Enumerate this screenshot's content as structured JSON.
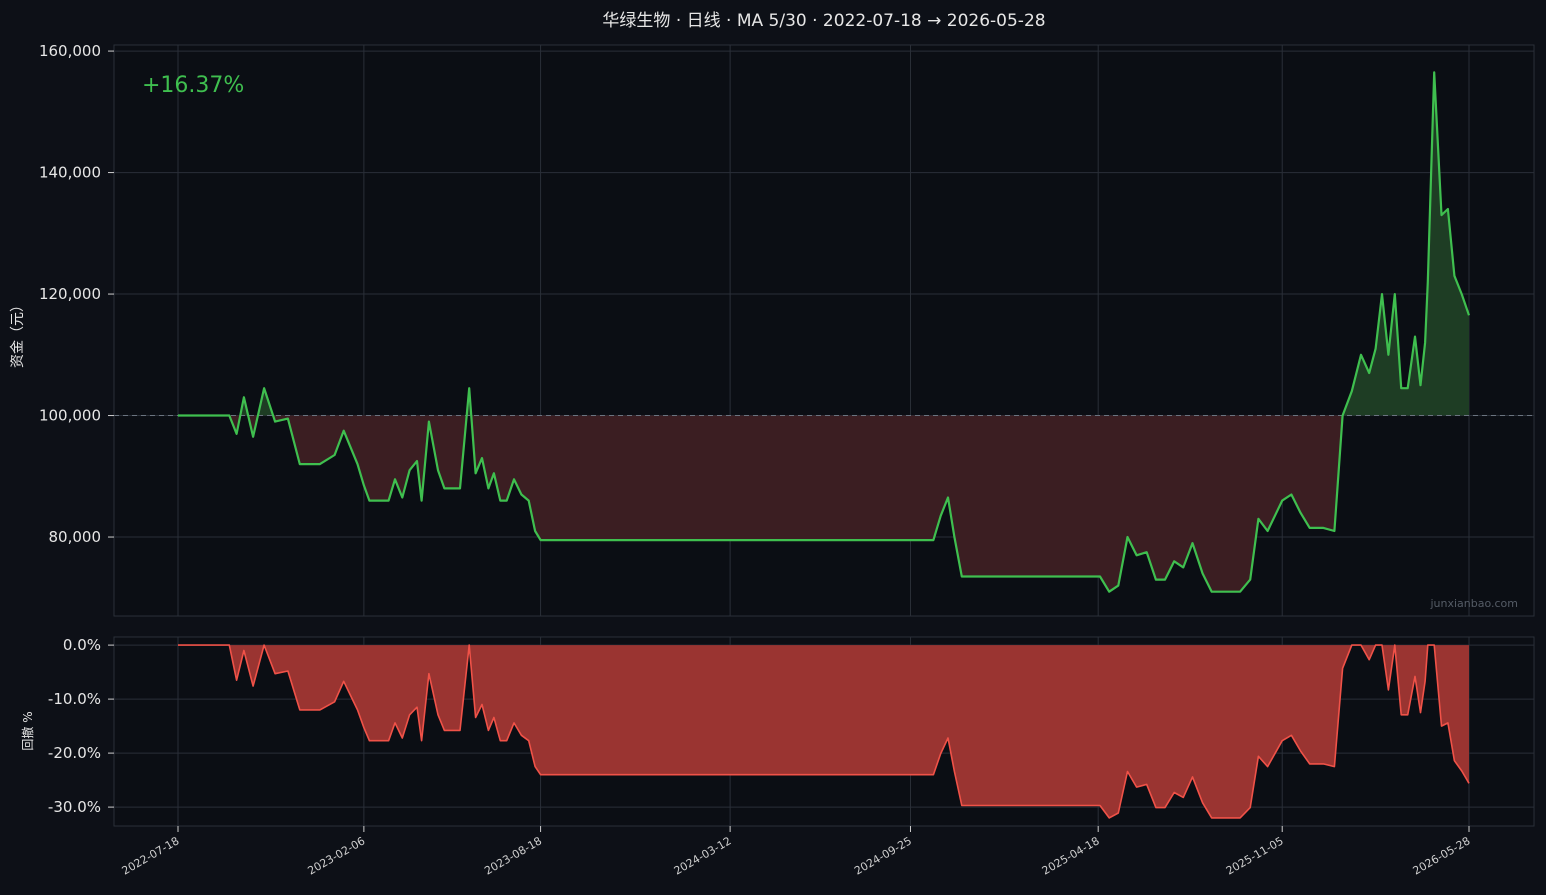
{
  "title": "华绿生物 · 日线 · MA 5/30 · 2022-07-18 → 2026-05-28",
  "return_label": "+16.37%",
  "watermark": "junxianbao.com",
  "colors": {
    "background": "#0d1017",
    "equity_line": "#3fbf4f",
    "equity_up_fill": "#1e3d24",
    "equity_down_fill": "#3b1e22",
    "drawdown": "#f05248",
    "drawdown_fill": "#9a3431",
    "baseline": "#6b7480"
  },
  "chart_data": [
    {
      "type": "area",
      "name": "equity",
      "ylabel": "资金（元）",
      "ylim": [
        67000,
        161000
      ],
      "yticks": [
        80000,
        100000,
        120000,
        140000,
        160000
      ],
      "ytick_labels": [
        "80,000",
        "100,000",
        "120,000",
        "140,000",
        "160,000"
      ],
      "baseline": 100000,
      "x_range": [
        "2022-07-18",
        "2026-05-28"
      ],
      "xticks": [
        "2022-07-18",
        "2023-02-06",
        "2023-08-18",
        "2024-03-12",
        "2024-09-25",
        "2025-04-18",
        "2025-11-05",
        "2026-05-28"
      ],
      "x": [
        "2022-07-18",
        "2022-09-12",
        "2022-09-20",
        "2022-09-28",
        "2022-10-08",
        "2022-10-20",
        "2022-11-01",
        "2022-11-15",
        "2022-11-28",
        "2022-12-05",
        "2022-12-08",
        "2022-12-20",
        "2023-01-05",
        "2023-01-15",
        "2023-01-30",
        "2023-02-06",
        "2023-02-12",
        "2023-02-18",
        "2023-02-25",
        "2023-03-05",
        "2023-03-12",
        "2023-03-20",
        "2023-03-28",
        "2023-04-05",
        "2023-04-10",
        "2023-04-18",
        "2023-04-28",
        "2023-05-05",
        "2023-05-12",
        "2023-05-22",
        "2023-06-01",
        "2023-06-08",
        "2023-06-15",
        "2023-06-22",
        "2023-06-28",
        "2023-07-05",
        "2023-07-12",
        "2023-07-20",
        "2023-07-28",
        "2023-08-05",
        "2023-08-12",
        "2023-08-18",
        "2023-09-01",
        "2024-10-20",
        "2024-10-28",
        "2024-11-05",
        "2024-11-12",
        "2024-11-20",
        "2024-12-01",
        "2025-04-10",
        "2025-04-20",
        "2025-04-30",
        "2025-05-10",
        "2025-05-20",
        "2025-05-30",
        "2025-06-10",
        "2025-06-20",
        "2025-06-30",
        "2025-07-10",
        "2025-07-20",
        "2025-07-30",
        "2025-08-10",
        "2025-08-20",
        "2025-09-20",
        "2025-10-01",
        "2025-10-10",
        "2025-10-20",
        "2025-11-05",
        "2025-11-15",
        "2025-11-25",
        "2025-12-05",
        "2025-12-20",
        "2026-01-01",
        "2026-01-10",
        "2026-01-20",
        "2026-01-30",
        "2026-02-08",
        "2026-02-15",
        "2026-02-22",
        "2026-03-01",
        "2026-03-08",
        "2026-03-15",
        "2026-03-22",
        "2026-03-30",
        "2026-04-05",
        "2026-04-10",
        "2026-04-13",
        "2026-04-20",
        "2026-04-28",
        "2026-05-05",
        "2026-05-12",
        "2026-05-20",
        "2026-05-28"
      ],
      "values": [
        100000,
        100000,
        97000,
        103000,
        96500,
        104500,
        99000,
        99500,
        92000,
        92000,
        92000,
        92000,
        93500,
        97500,
        92000,
        88500,
        86000,
        86000,
        86000,
        86000,
        89500,
        86500,
        91000,
        92500,
        86000,
        99000,
        91000,
        88000,
        88000,
        88000,
        104500,
        90500,
        93000,
        88000,
        90500,
        86000,
        86000,
        89500,
        87000,
        86000,
        81000,
        79500,
        79500,
        79500,
        83500,
        86500,
        80000,
        73500,
        73500,
        73500,
        73500,
        71000,
        72000,
        80000,
        77000,
        77500,
        73000,
        73000,
        76000,
        75000,
        79000,
        74000,
        71000,
        71000,
        73000,
        83000,
        81000,
        86000,
        87000,
        84000,
        81500,
        81500,
        81000,
        100000,
        104000,
        110000,
        107000,
        111000,
        120000,
        110000,
        120000,
        104500,
        104500,
        113000,
        105000,
        112000,
        122000,
        156500,
        133000,
        134000,
        123000,
        120000,
        116500
      ]
    },
    {
      "type": "area",
      "name": "drawdown",
      "ylabel": "回撤 %",
      "ylim": [
        -33.5,
        1.5
      ],
      "yticks": [
        0,
        -10,
        -20,
        -30
      ],
      "ytick_labels": [
        "0.0%",
        "-10.0%",
        "-20.0%",
        "-30.0%"
      ],
      "x_range": [
        "2022-07-18",
        "2026-05-28"
      ],
      "x": [
        "2022-07-18",
        "2022-09-12",
        "2022-09-20",
        "2022-09-28",
        "2022-10-08",
        "2022-10-20",
        "2022-11-01",
        "2022-11-15",
        "2022-11-28",
        "2022-12-05",
        "2022-12-08",
        "2022-12-20",
        "2023-01-05",
        "2023-01-15",
        "2023-01-30",
        "2023-02-06",
        "2023-02-12",
        "2023-02-18",
        "2023-02-25",
        "2023-03-05",
        "2023-03-12",
        "2023-03-20",
        "2023-03-28",
        "2023-04-05",
        "2023-04-10",
        "2023-04-18",
        "2023-04-28",
        "2023-05-05",
        "2023-05-12",
        "2023-05-22",
        "2023-06-01",
        "2023-06-08",
        "2023-06-15",
        "2023-06-22",
        "2023-06-28",
        "2023-07-05",
        "2023-07-12",
        "2023-07-20",
        "2023-07-28",
        "2023-08-05",
        "2023-08-12",
        "2023-08-18",
        "2023-09-01",
        "2024-10-20",
        "2024-10-28",
        "2024-11-05",
        "2024-11-12",
        "2024-11-20",
        "2024-12-01",
        "2025-04-10",
        "2025-04-20",
        "2025-04-30",
        "2025-05-10",
        "2025-05-20",
        "2025-05-30",
        "2025-06-10",
        "2025-06-20",
        "2025-06-30",
        "2025-07-10",
        "2025-07-20",
        "2025-07-30",
        "2025-08-10",
        "2025-08-20",
        "2025-09-20",
        "2025-10-01",
        "2025-10-10",
        "2025-10-20",
        "2025-11-05",
        "2025-11-15",
        "2025-11-25",
        "2025-12-05",
        "2025-12-20",
        "2026-01-01",
        "2026-01-10",
        "2026-01-20",
        "2026-01-30",
        "2026-02-08",
        "2026-02-15",
        "2026-02-22",
        "2026-03-01",
        "2026-03-08",
        "2026-03-15",
        "2026-03-22",
        "2026-03-30",
        "2026-04-05",
        "2026-04-10",
        "2026-04-13",
        "2026-04-20",
        "2026-04-28",
        "2026-05-05",
        "2026-05-12",
        "2026-05-20",
        "2026-05-28"
      ],
      "values": [
        0,
        0,
        -6.5,
        -1,
        -7.6,
        0,
        -5.3,
        -4.8,
        -12,
        -12,
        -12,
        -12,
        -10.5,
        -6.7,
        -12,
        -15.3,
        -17.7,
        -17.7,
        -17.7,
        -17.7,
        -14.4,
        -17.2,
        -12.9,
        -11.5,
        -17.7,
        -5.3,
        -12.9,
        -15.8,
        -15.8,
        -15.8,
        0,
        -13.4,
        -11,
        -15.8,
        -13.4,
        -17.7,
        -17.7,
        -14.4,
        -16.7,
        -17.7,
        -22.5,
        -24,
        -24,
        -24,
        -20.1,
        -17.2,
        -23.4,
        -29.7,
        -29.7,
        -29.7,
        -29.7,
        -32,
        -31.1,
        -23.4,
        -26.3,
        -25.8,
        -30.1,
        -30.1,
        -27.3,
        -28.2,
        -24.4,
        -29.2,
        -32,
        -32,
        -30.1,
        -20.6,
        -22.5,
        -17.7,
        -16.7,
        -19.6,
        -22,
        -22,
        -22.5,
        -4.3,
        0,
        0,
        -2.7,
        0,
        0,
        -8.3,
        0,
        -12.9,
        -12.9,
        -5.8,
        -12.5,
        -6.7,
        0,
        0,
        -15,
        -14.4,
        -21.4,
        -23.3,
        -25.6
      ]
    }
  ]
}
